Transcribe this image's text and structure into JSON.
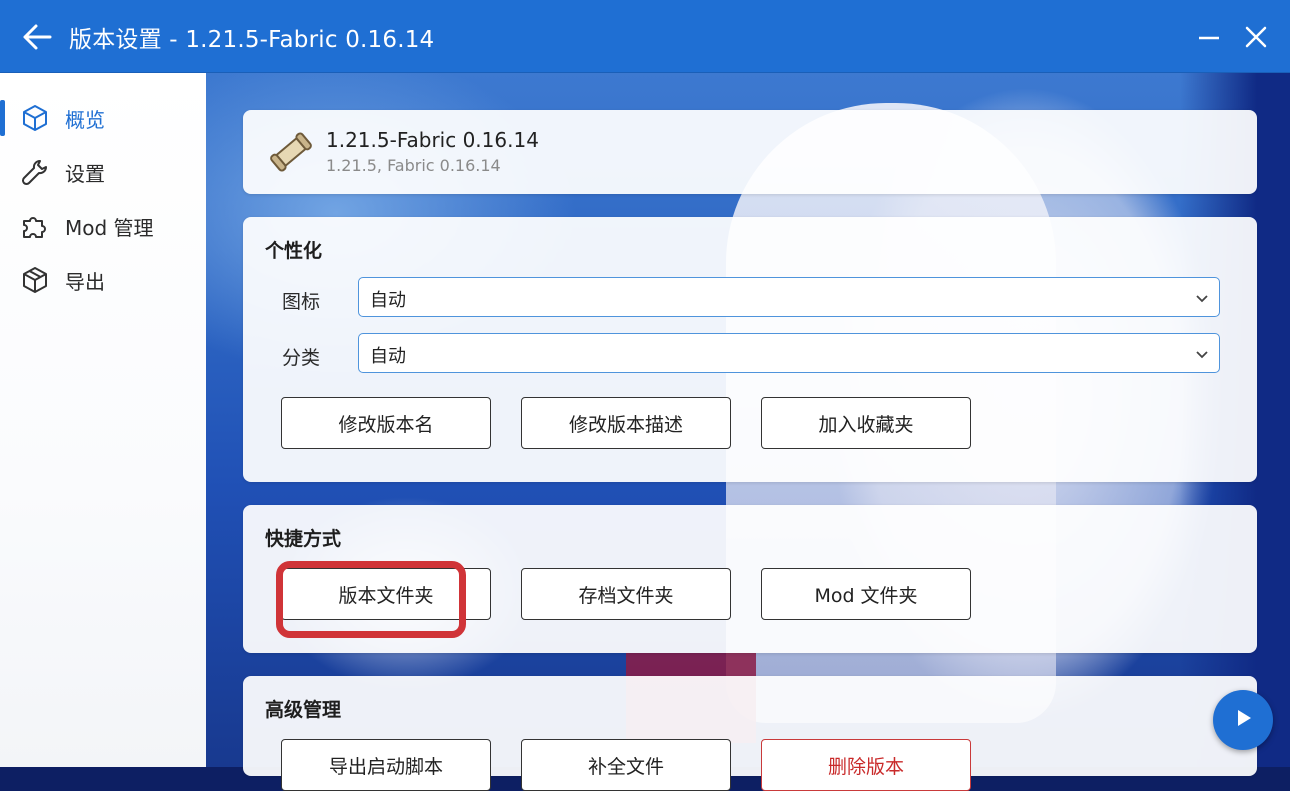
{
  "window": {
    "title": "版本设置 - 1.21.5-Fabric 0.16.14",
    "accent": "#1f6fd3"
  },
  "sidebar": {
    "items": [
      {
        "label": "概览",
        "icon": "cube-icon",
        "active": true
      },
      {
        "label": "设置",
        "icon": "wrench-icon",
        "active": false
      },
      {
        "label": "Mod 管理",
        "icon": "puzzle-icon",
        "active": false
      },
      {
        "label": "导出",
        "icon": "box-icon",
        "active": false
      }
    ]
  },
  "version": {
    "name": "1.21.5-Fabric 0.16.14",
    "detail": "1.21.5, Fabric 0.16.14",
    "icon": "scroll-icon"
  },
  "personalization": {
    "title": "个性化",
    "icon_label": "图标",
    "icon_value": "自动",
    "category_label": "分类",
    "category_value": "自动",
    "buttons": [
      "修改版本名",
      "修改版本描述",
      "加入收藏夹"
    ]
  },
  "shortcuts": {
    "title": "快捷方式",
    "buttons": [
      "版本文件夹",
      "存档文件夹",
      "Mod 文件夹"
    ],
    "highlighted_color": "#d03438"
  },
  "advanced": {
    "title": "高级管理",
    "buttons": [
      "导出启动脚本",
      "补全文件",
      "删除版本"
    ],
    "danger_color": "#c92a2a"
  }
}
